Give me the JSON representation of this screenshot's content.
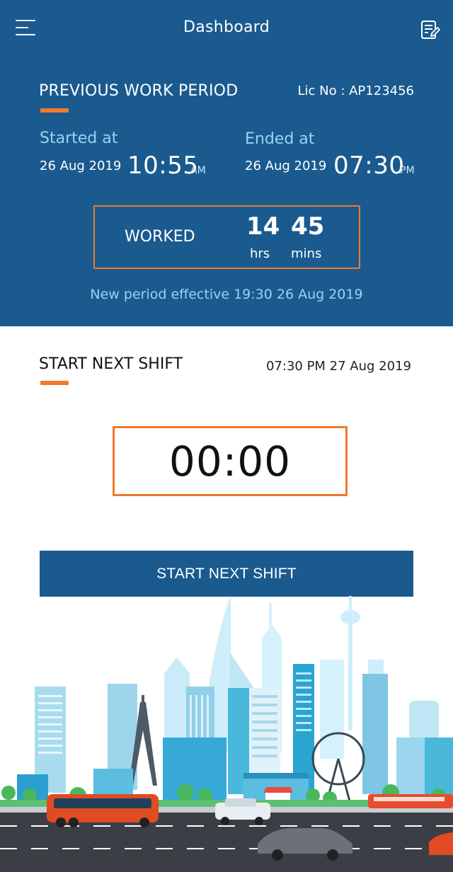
{
  "header": {
    "title": "Dashboard",
    "menu_icon": "hamburger-menu-icon",
    "notes_icon": "note-edit-icon"
  },
  "previous_period": {
    "title": "PREVIOUS WORK PERIOD",
    "license": "Lic No : AP123456",
    "started": {
      "label": "Started at",
      "date": "26 Aug 2019",
      "time": "10:55",
      "ampm": "AM"
    },
    "ended": {
      "label": "Ended at",
      "date": "26 Aug 2019",
      "time": "07:30",
      "ampm": "PM"
    },
    "worked": {
      "label": "WORKED",
      "hours": "14",
      "hours_unit": "hrs",
      "minutes": "45",
      "minutes_unit": "mins"
    },
    "new_period_note": "New period effective 19:30 26 Aug 2019"
  },
  "next_shift": {
    "title": "START NEXT SHIFT",
    "datetime": "07:30 PM 27 Aug 2019",
    "timer": "00:00",
    "button_label": "START NEXT SHIFT"
  },
  "colors": {
    "primary": "#1a5a8f",
    "accent": "#ef7a2a",
    "light_label": "#9fd0f2"
  }
}
